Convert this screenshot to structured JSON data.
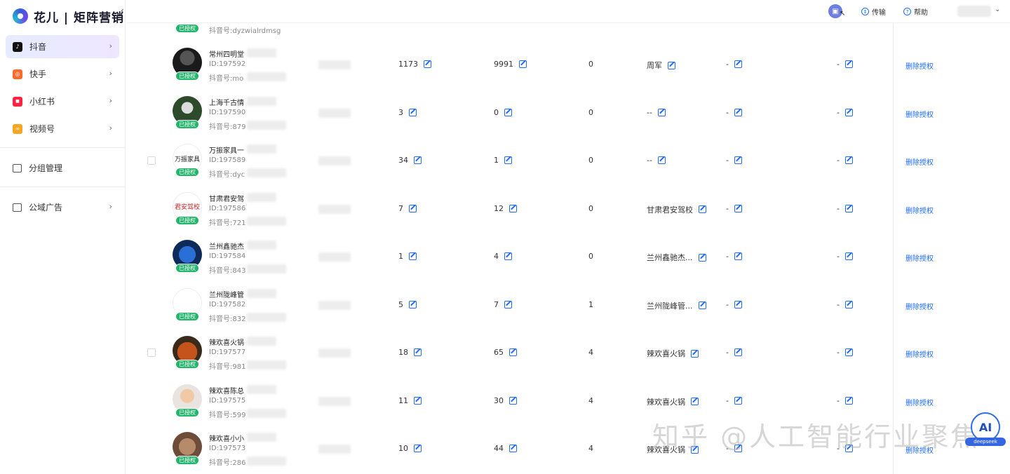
{
  "app": {
    "logo_text": "花儿 | 矩阵营销"
  },
  "sidebar": {
    "items": [
      {
        "label": "抖音",
        "icon": "douyin-icon",
        "active": true
      },
      {
        "label": "快手",
        "icon": "kuaishou-icon"
      },
      {
        "label": "小红书",
        "icon": "xiaohongshu-icon"
      },
      {
        "label": "视频号",
        "icon": "channels-icon"
      }
    ],
    "group_label": "分组管理",
    "ad_label": "公域广告"
  },
  "topbar": {
    "transfer_label": "传输",
    "help_label": "帮助"
  },
  "table": {
    "partial_row": {
      "badge": "已授权",
      "douyin": "抖音号:dyzwialrdmsg"
    },
    "rows": [
      {
        "name": "常州四明堂",
        "id": "ID:197592",
        "douyin": "抖音号:mo",
        "col1": "1173",
        "col2": "9991",
        "col3": "0",
        "col4": "周军",
        "col5": "-",
        "col6": "-",
        "badge": "已授权",
        "action": "删除授权"
      },
      {
        "name": "上海千古情",
        "id": "ID:197590",
        "douyin": "抖音号:879",
        "col1": "3",
        "col2": "0",
        "col3": "0",
        "col4": "--",
        "col5": "-",
        "col6": "-",
        "badge": "已授权",
        "action": "删除授权"
      },
      {
        "name": "万振家具一",
        "id": "ID:197589",
        "douyin": "抖音号:dyc",
        "col1": "34",
        "col2": "1",
        "col3": "0",
        "col4": "--",
        "col5": "-",
        "col6": "-",
        "badge": "已授权",
        "action": "删除授权"
      },
      {
        "name": "甘肃君安驾",
        "id": "ID:197586",
        "douyin": "抖音号:721",
        "col1": "7",
        "col2": "12",
        "col3": "0",
        "col4": "甘肃君安驾校",
        "col5": "-",
        "col6": "-",
        "badge": "已授权",
        "action": "删除授权"
      },
      {
        "name": "兰州鑫驰杰",
        "id": "ID:197584",
        "douyin": "抖音号:843",
        "col1": "1",
        "col2": "4",
        "col3": "0",
        "col4": "兰州鑫驰杰...",
        "col5": "-",
        "col6": "-",
        "badge": "已授权",
        "action": "删除授权"
      },
      {
        "name": "兰州陇峰管",
        "id": "ID:197582",
        "douyin": "抖音号:832",
        "col1": "5",
        "col2": "7",
        "col3": "1",
        "col4": "兰州陇峰管...",
        "col5": "-",
        "col6": "-",
        "badge": "已授权",
        "action": "删除授权"
      },
      {
        "name": "辣欢喜火锅",
        "id": "ID:197577",
        "douyin": "抖音号:981",
        "col1": "18",
        "col2": "65",
        "col3": "4",
        "col4": "辣欢喜火锅",
        "col5": "-",
        "col6": "-",
        "badge": "已授权",
        "action": "删除授权"
      },
      {
        "name": "辣欢喜陈总",
        "id": "ID:197575",
        "douyin": "抖音号:599",
        "col1": "11",
        "col2": "30",
        "col3": "4",
        "col4": "辣欢喜火锅",
        "col5": "-",
        "col6": "-",
        "badge": "已授权",
        "action": "删除授权"
      },
      {
        "name": "辣欢喜小小",
        "id": "ID:197573",
        "douyin": "抖音号:286",
        "col1": "10",
        "col2": "44",
        "col3": "4",
        "col4": "辣欢喜火锅",
        "col5": "-",
        "col6": "-",
        "badge": "已授权",
        "action": "删除授权"
      }
    ],
    "avatars": [
      "wanzhen-logo-text"
    ]
  },
  "avatar_texts": {
    "row2": "万振家具",
    "row3": "君安驾校"
  },
  "watermark": "知乎 @人工智能行业聚焦",
  "ai_badge": "AI",
  "ds_pill": "deepseek",
  "colors": {
    "accent": "#1d6cff",
    "badge": "#23b56b"
  }
}
